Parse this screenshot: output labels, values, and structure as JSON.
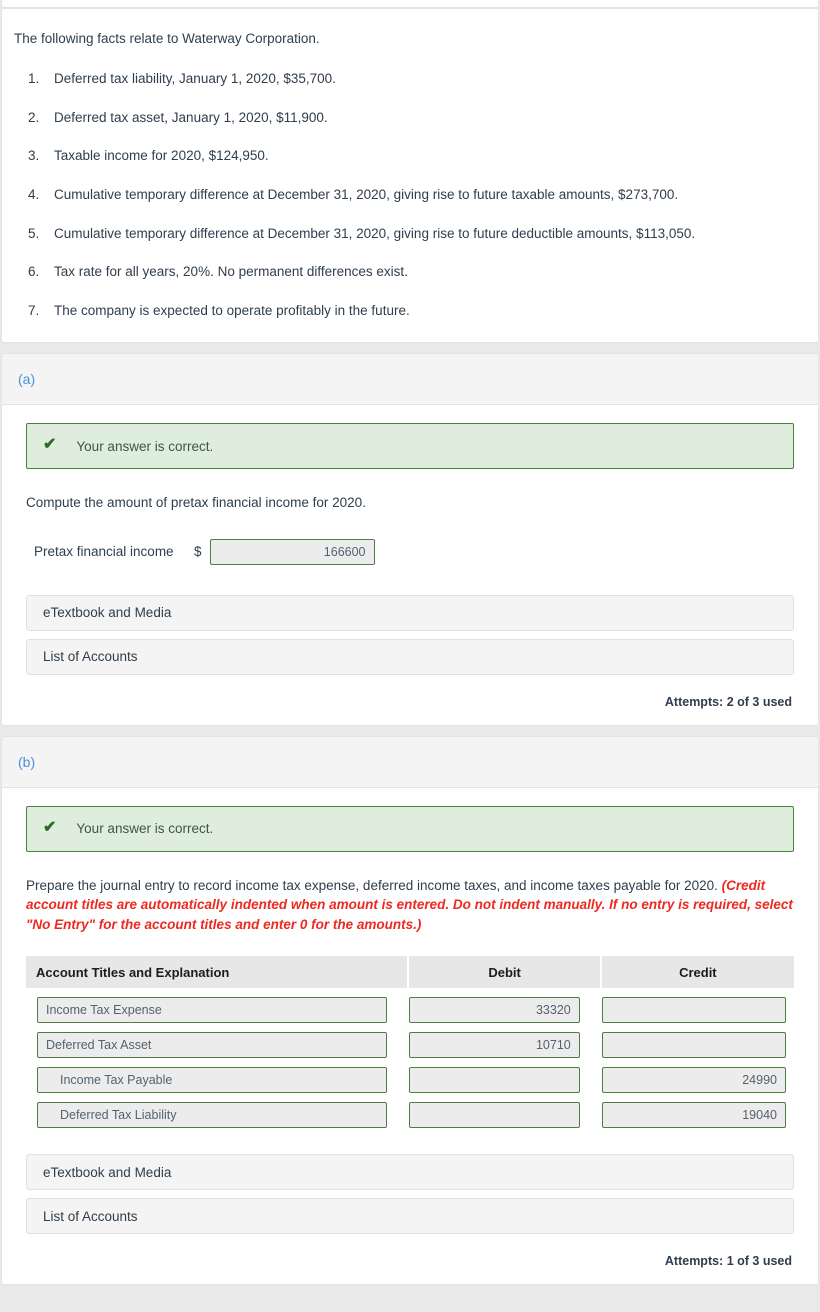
{
  "facts": {
    "intro": "The following facts relate to Waterway Corporation.",
    "items": [
      {
        "num": "1.",
        "text": "Deferred tax liability, January 1, 2020, $35,700."
      },
      {
        "num": "2.",
        "text": "Deferred tax asset, January 1, 2020, $11,900."
      },
      {
        "num": "3.",
        "text": "Taxable income for 2020, $124,950."
      },
      {
        "num": "4.",
        "text": "Cumulative temporary difference at December 31, 2020, giving rise to future taxable amounts, $273,700."
      },
      {
        "num": "5.",
        "text": "Cumulative temporary difference at December 31, 2020, giving rise to future deductible amounts, $113,050."
      },
      {
        "num": "6.",
        "text": "Tax rate for all years, 20%. No permanent differences exist."
      },
      {
        "num": "7.",
        "text": "The company is expected to operate profitably in the future."
      }
    ]
  },
  "part_a": {
    "label": "(a)",
    "feedback": {
      "icon": "check-icon",
      "text": "Your answer is correct."
    },
    "prompt": "Compute the amount of pretax financial income for 2020.",
    "answer": {
      "label": "Pretax financial income",
      "currency_symbol": "$",
      "value": "166600"
    },
    "etextbook_label": "eTextbook and Media",
    "list_of_accounts_label": "List of Accounts",
    "attempts": "Attempts: 2 of 3 used"
  },
  "part_b": {
    "label": "(b)",
    "feedback": {
      "icon": "check-icon",
      "text": "Your answer is correct."
    },
    "prompt_main": "Prepare the journal entry to record income tax expense, deferred income taxes, and income taxes payable for 2020. ",
    "prompt_note": "(Credit account titles are automatically indented when amount is entered. Do not indent manually. If no entry is required, select \"No Entry\" for the account titles and enter 0 for the amounts.)",
    "table": {
      "headers": {
        "account": "Account Titles and Explanation",
        "debit": "Debit",
        "credit": "Credit"
      },
      "rows": [
        {
          "account": "Income Tax Expense",
          "indent": false,
          "debit": "33320",
          "credit": ""
        },
        {
          "account": "Deferred Tax Asset",
          "indent": false,
          "debit": "10710",
          "credit": ""
        },
        {
          "account": "Income Tax Payable",
          "indent": true,
          "debit": "",
          "credit": "24990"
        },
        {
          "account": "Deferred Tax Liability",
          "indent": true,
          "debit": "",
          "credit": "19040"
        }
      ]
    },
    "etextbook_label": "eTextbook and Media",
    "list_of_accounts_label": "List of Accounts",
    "attempts": "Attempts: 1 of 3 used"
  },
  "colors": {
    "accent_blue": "#4a90d9",
    "success_border": "#4f7e45",
    "success_bg": "#dfeedc",
    "note_red": "#ec2a20",
    "input_border": "#4f7e45",
    "input_bg": "#ececec"
  }
}
